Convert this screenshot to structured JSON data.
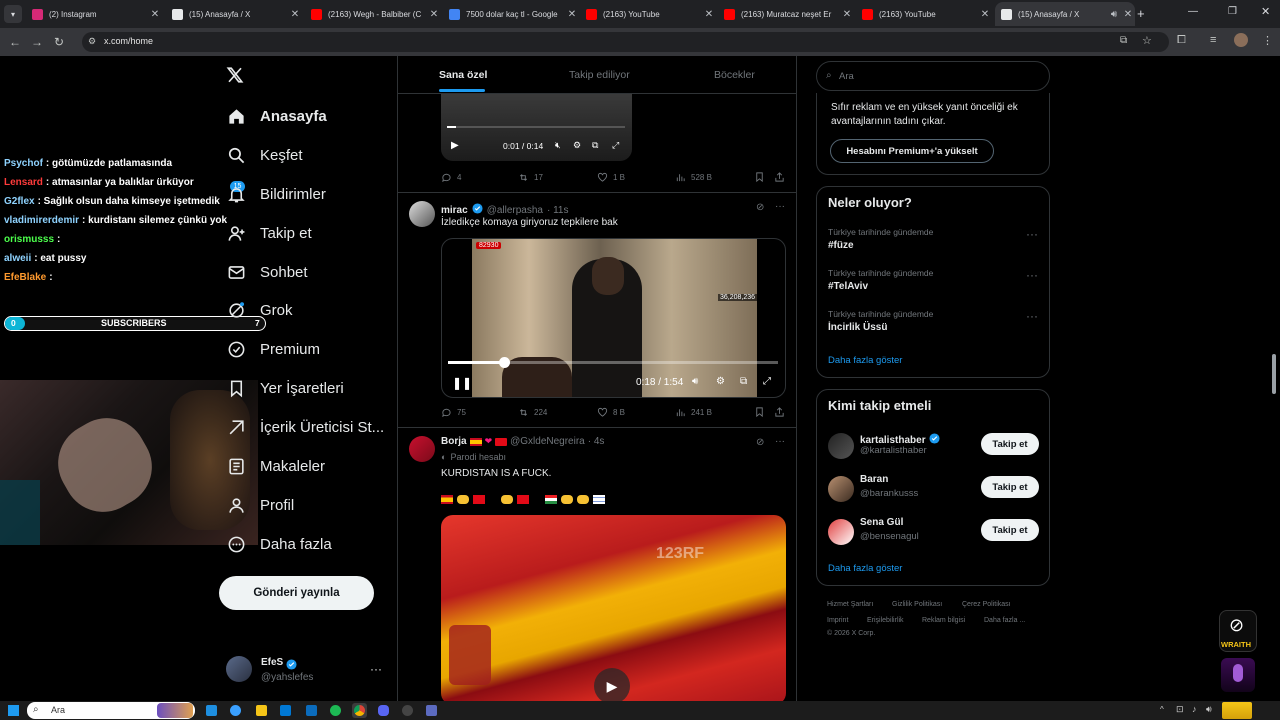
{
  "browser": {
    "tabs": [
      {
        "title": "(2) Instagram",
        "color": "#d62976"
      },
      {
        "title": "(15) Anasayfa / X",
        "color": "#e7e9ea"
      },
      {
        "title": "(2163) Wegh - Balbiber (C",
        "color": "#ff0000"
      },
      {
        "title": "7500 dolar kaç tl - Google",
        "color": "#4285f4"
      },
      {
        "title": "(2163) YouTube",
        "color": "#ff0000"
      },
      {
        "title": "(2163) Muratcaz neşet Er",
        "color": "#ff0000"
      },
      {
        "title": "(2163) YouTube",
        "color": "#ff0000"
      },
      {
        "title": "(15) Anasayfa / X",
        "color": "#e7e9ea"
      }
    ],
    "url": "x.com/home"
  },
  "stream": {
    "chat": [
      {
        "user": "Psychof",
        "msg": ": götümüzde patlamasında",
        "color": "#8fd3ff"
      },
      {
        "user": "Lensard",
        "msg": ": atmasınlar ya balıklar ürküyor",
        "color": "#ff3b3b"
      },
      {
        "user": "G2flex",
        "msg": ": Sağlık olsun daha kimseye işetmedik",
        "color": "#8fd3ff"
      },
      {
        "user": "vladimirerdemir",
        "msg": ": kurdistanı silemez çünkü yok",
        "color": "#8fd3ff"
      },
      {
        "user": "orismusss",
        "msg": ":",
        "color": "#4cff4c"
      },
      {
        "user": "alweii",
        "msg": ": eat pussy",
        "color": "#8fd3ff"
      },
      {
        "user": "EfeBlake",
        "msg": ":",
        "color": "#ff9a2e"
      }
    ],
    "sub_count_left": "0",
    "sub_label": "SUBSCRIBERS",
    "sub_count_right": "7",
    "wraith_label": "WRAITH"
  },
  "nav": {
    "items": [
      {
        "label": "Anasayfa",
        "icon": "home-icon"
      },
      {
        "label": "Keşfet",
        "icon": "search-icon"
      },
      {
        "label": "Bildirimler",
        "icon": "bell-icon",
        "badge": "15"
      },
      {
        "label": "Takip et",
        "icon": "add-user-icon"
      },
      {
        "label": "Sohbet",
        "icon": "mail-icon"
      },
      {
        "label": "Grok",
        "icon": "grok-icon"
      },
      {
        "label": "Premium",
        "icon": "verified-icon"
      },
      {
        "label": "Yer İşaretleri",
        "icon": "bookmark-icon"
      },
      {
        "label": "İçerik Üreticisi St...",
        "icon": "creator-icon"
      },
      {
        "label": "Makaleler",
        "icon": "article-icon"
      },
      {
        "label": "Profil",
        "icon": "profile-icon"
      },
      {
        "label": "Daha fazla",
        "icon": "more-icon"
      }
    ],
    "post_button": "Gönderi yayınla",
    "account": {
      "name": "EfeS",
      "handle": "@yahslefes"
    }
  },
  "feed": {
    "tabs": [
      "Sana özel",
      "Takip ediliyor",
      "Böcekler"
    ],
    "tweet0": {
      "video_time": "0:01 / 0:14",
      "replies": "4",
      "reposts": "17",
      "likes": "1 B",
      "views": "528 B"
    },
    "tweet1": {
      "name": "mirac",
      "handle": "@allerpasha",
      "time": "· 11s",
      "text": "İzledikçe komaya giriyoruz tepkilere bak",
      "video_time": "0:18 / 1:54",
      "video_overlay_count": "36,208,236",
      "video_overlay_tag": "82930",
      "progress": 0.17,
      "replies": "75",
      "reposts": "224",
      "likes": "8 B",
      "views": "241 B"
    },
    "tweet2": {
      "name": "Borja",
      "handle": "@GxldeNegreira",
      "time": "· 4s",
      "parody": "Parodi hesabı",
      "text": "KURDISTAN IS A FUCK.",
      "watermark": "123RF"
    }
  },
  "right": {
    "search_placeholder": "Ara",
    "premium_text": "Sıfır reklam ve en yüksek yanıt önceliği ek avantajlarının tadını çıkar.",
    "premium_button": "Hesabını Premium+'a yükselt",
    "trends_title": "Neler oluyor?",
    "trends": [
      {
        "sub": "Türkiye tarihinde gündemde",
        "title": "#füze"
      },
      {
        "sub": "Türkiye tarihinde gündemde",
        "title": "#TelAviv"
      },
      {
        "sub": "Türkiye tarihinde gündemde",
        "title": "İncirlik Üssü"
      }
    ],
    "show_more": "Daha fazla göster",
    "wtf_title": "Kimi takip etmeli",
    "wtf": [
      {
        "name": "kartalisthaber",
        "handle": "@kartalisthaber",
        "verified": true
      },
      {
        "name": "Baran",
        "handle": "@barankusss",
        "verified": false
      },
      {
        "name": "Sena Gül",
        "handle": "@bensenagul",
        "verified": false
      }
    ],
    "follow_label": "Takip et",
    "footer": [
      "Hizmet Şartları",
      "Gizlilik Politikası",
      "Çerez Politikası",
      "Imprint",
      "Erişilebilirlik",
      "Reklam bilgisi",
      "Daha fazla ...",
      "© 2026 X Corp."
    ]
  },
  "taskbar": {
    "search": "Ara"
  }
}
